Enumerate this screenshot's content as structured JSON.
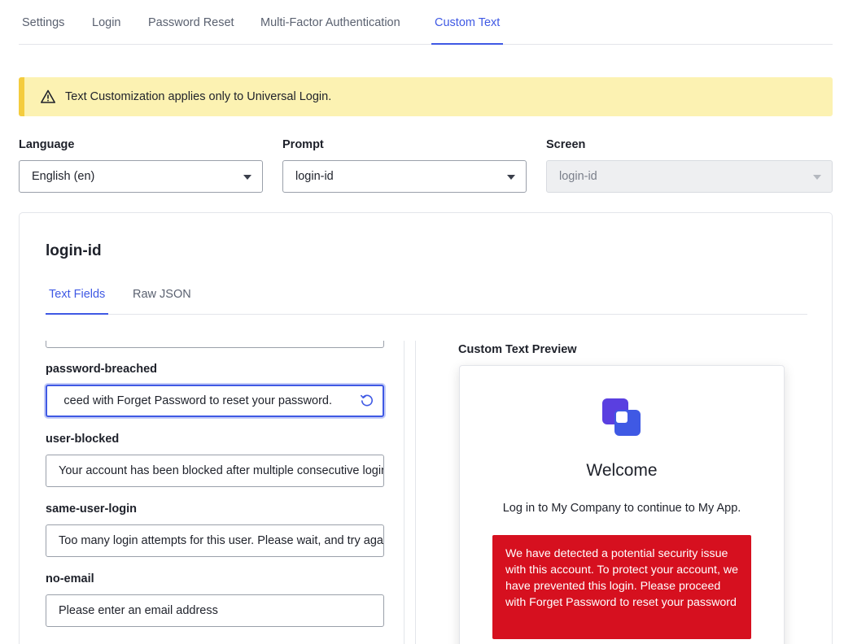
{
  "top_tabs": [
    {
      "label": "Settings"
    },
    {
      "label": "Login"
    },
    {
      "label": "Password Reset"
    },
    {
      "label": "Multi-Factor Authentication"
    },
    {
      "label": "Custom Text",
      "active": true
    }
  ],
  "banner": {
    "text": "Text Customization applies only to Universal Login.",
    "icon": "warning-icon"
  },
  "selectors": {
    "language": {
      "label": "Language",
      "value": "English (en)"
    },
    "prompt": {
      "label": "Prompt",
      "value": "login-id"
    },
    "screen": {
      "label": "Screen",
      "value": "login-id",
      "disabled": true
    }
  },
  "panel": {
    "title": "login-id",
    "tabs": [
      {
        "label": "Text Fields",
        "active": true
      },
      {
        "label": "Raw JSON"
      }
    ]
  },
  "fields": [
    {
      "label": "",
      "value": ""
    },
    {
      "label": "password-breached",
      "value": "ceed with Forget Password to reset your password.",
      "focused": true
    },
    {
      "label": "user-blocked",
      "value": "Your account has been blocked after multiple consecutive login attempts."
    },
    {
      "label": "same-user-login",
      "value": "Too many login attempts for this user. Please wait, and try again later."
    },
    {
      "label": "no-email",
      "value": "Please enter an email address"
    }
  ],
  "preview": {
    "label": "Custom Text Preview",
    "welcome": "Welcome",
    "subtitle": "Log in to My Company to continue to My App.",
    "error": "We have detected a potential security issue with this account. To protect your account, we have prevented this login. Please proceed with Forget Password to reset your password"
  },
  "colors": {
    "accent": "#3f59e4",
    "warning_bg": "#fcf2b2",
    "error_bg": "#d6101f"
  }
}
